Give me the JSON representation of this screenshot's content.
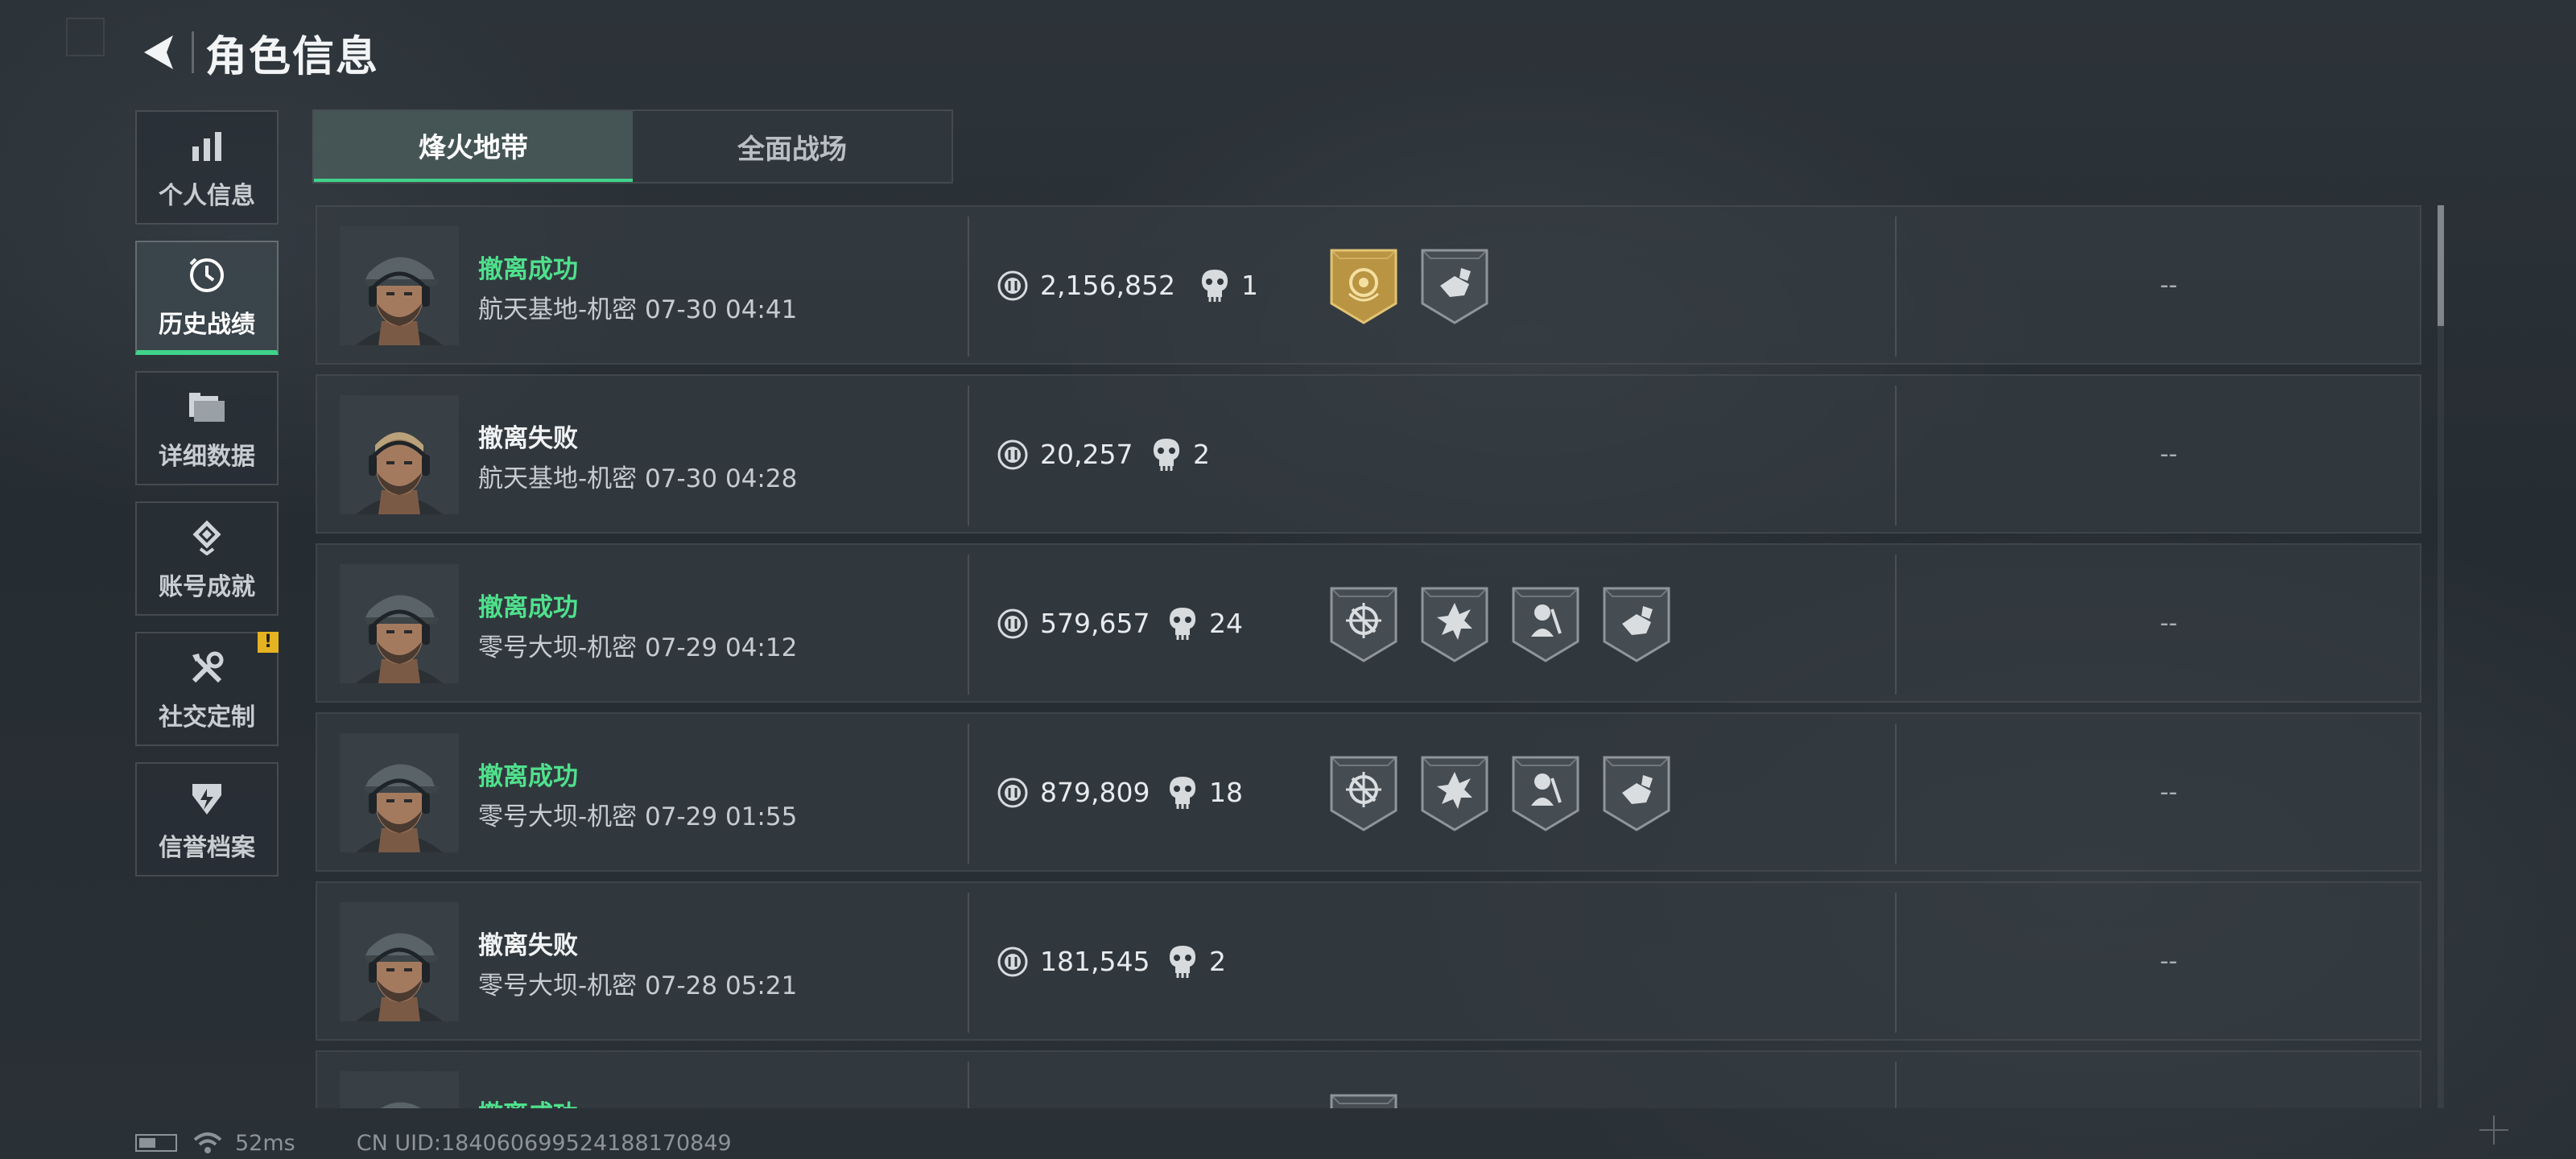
{
  "header": {
    "title": "角色信息"
  },
  "sidebar": {
    "items": [
      {
        "label": "个人信息",
        "icon": "bar-chart-icon"
      },
      {
        "label": "历史战绩",
        "icon": "clock-icon",
        "active": true
      },
      {
        "label": "详细数据",
        "icon": "folders-icon"
      },
      {
        "label": "账号成就",
        "icon": "achievement-icon"
      },
      {
        "label": "社交定制",
        "icon": "tools-icon",
        "badge": "!"
      },
      {
        "label": "信誉档案",
        "icon": "shield-icon"
      }
    ]
  },
  "tabs": [
    {
      "label": "烽火地带",
      "active": true
    },
    {
      "label": "全面战场",
      "active": false
    }
  ],
  "matches": [
    {
      "result": "撤离成功",
      "success": true,
      "map_time": "航天基地-机密 07-30 04:41",
      "money": "2,156,852",
      "kills": "1",
      "medals": [
        "gold-medal-icon",
        "shield-hand-medal-icon"
      ],
      "extra": "--"
    },
    {
      "result": "撤离失败",
      "success": false,
      "map_time": "航天基地-机密 07-30 04:28",
      "money": "20,257",
      "kills": "2",
      "medals": [],
      "extra": "--"
    },
    {
      "result": "撤离成功",
      "success": true,
      "map_time": "零号大坝-机密 07-29 04:12",
      "money": "579,657",
      "kills": "24",
      "medals": [
        "crosshair-medal-icon",
        "explosion-medal-icon",
        "soldier-medal-icon",
        "shield-hand-medal-icon"
      ],
      "extra": "--"
    },
    {
      "result": "撤离成功",
      "success": true,
      "map_time": "零号大坝-机密 07-29 01:55",
      "money": "879,809",
      "kills": "18",
      "medals": [
        "crosshair-medal-icon",
        "explosion-medal-icon",
        "soldier-medal-icon",
        "shield-hand-medal-icon"
      ],
      "extra": "--"
    },
    {
      "result": "撤离失败",
      "success": false,
      "map_time": "零号大坝-机密 07-28 05:21",
      "money": "181,545",
      "kills": "2",
      "medals": [],
      "extra": "--"
    },
    {
      "result": "撤离成功",
      "success": true,
      "map_time": "",
      "money": "",
      "kills": "",
      "medals": [
        "star-medal-icon"
      ],
      "extra": ""
    }
  ],
  "status_bar": {
    "ping": "52ms",
    "uid": "CN UID:1840606995241881708​49"
  },
  "colors": {
    "accent_green": "#3fd38a",
    "success_text": "#4fe08c",
    "warning": "#e6b320",
    "gold_medal": "#c9a24a"
  }
}
